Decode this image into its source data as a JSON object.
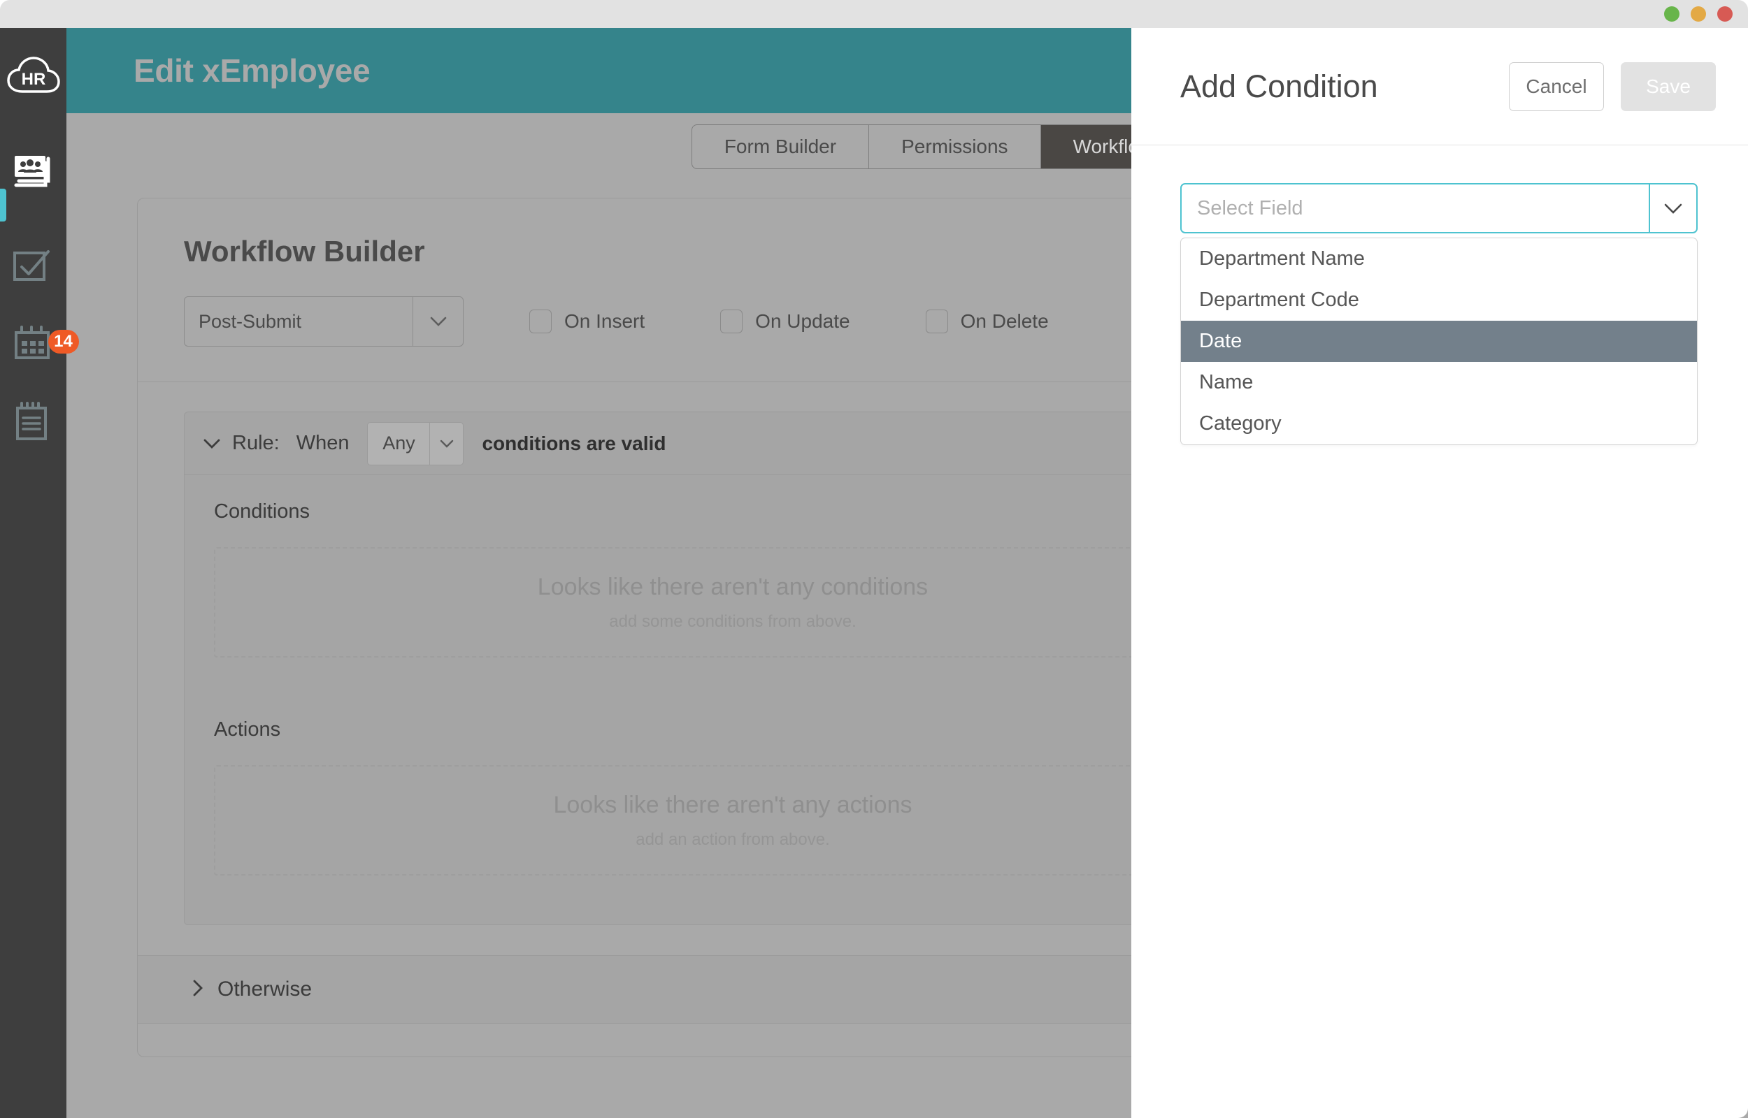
{
  "window": {
    "traffic_lights": [
      "green",
      "yellow",
      "red"
    ],
    "colors": {
      "teal_header": "#35848b",
      "accent_cyan": "#4ec3d0",
      "badge_orange": "#ef5a26",
      "sidebar_dark": "#3e3e3e",
      "dropdown_highlight": "#73808b"
    }
  },
  "sidebar": {
    "logo_text": "HR",
    "items": [
      {
        "icon": "people-book-icon",
        "active": true
      },
      {
        "icon": "checkbox-approval-icon",
        "active": false
      },
      {
        "icon": "calendar-icon",
        "active": false,
        "badge": "14"
      },
      {
        "icon": "clipboard-notes-icon",
        "active": false
      }
    ]
  },
  "header": {
    "title": "Edit xEmployee"
  },
  "tabs": [
    {
      "label": "Form Builder",
      "active": false
    },
    {
      "label": "Permissions",
      "active": false
    },
    {
      "label": "Workflow",
      "active": true
    }
  ],
  "main": {
    "section_title": "Workflow Builder",
    "trigger_select": {
      "value": "Post-Submit"
    },
    "checkboxes": [
      {
        "label": "On Insert",
        "checked": false
      },
      {
        "label": "On Update",
        "checked": false
      },
      {
        "label": "On Delete",
        "checked": false
      }
    ],
    "rule": {
      "label": "Rule:",
      "when": "When",
      "match_select": {
        "value": "Any"
      },
      "tail": "conditions are valid",
      "conditions": {
        "title": "Conditions",
        "empty_main": "Looks like there aren't any conditions",
        "empty_sub": "add some conditions from above."
      },
      "actions": {
        "title": "Actions",
        "empty_main": "Looks like there aren't any actions",
        "empty_sub": "add an action from above."
      }
    },
    "otherwise": {
      "label": "Otherwise"
    }
  },
  "panel": {
    "title": "Add Condition",
    "cancel_label": "Cancel",
    "save_label": "Save",
    "field_select": {
      "placeholder": "Select Field",
      "value": "",
      "options": [
        "Department Name",
        "Department Code",
        "Date",
        "Name",
        "Category"
      ],
      "highlighted_option": "Date"
    }
  }
}
